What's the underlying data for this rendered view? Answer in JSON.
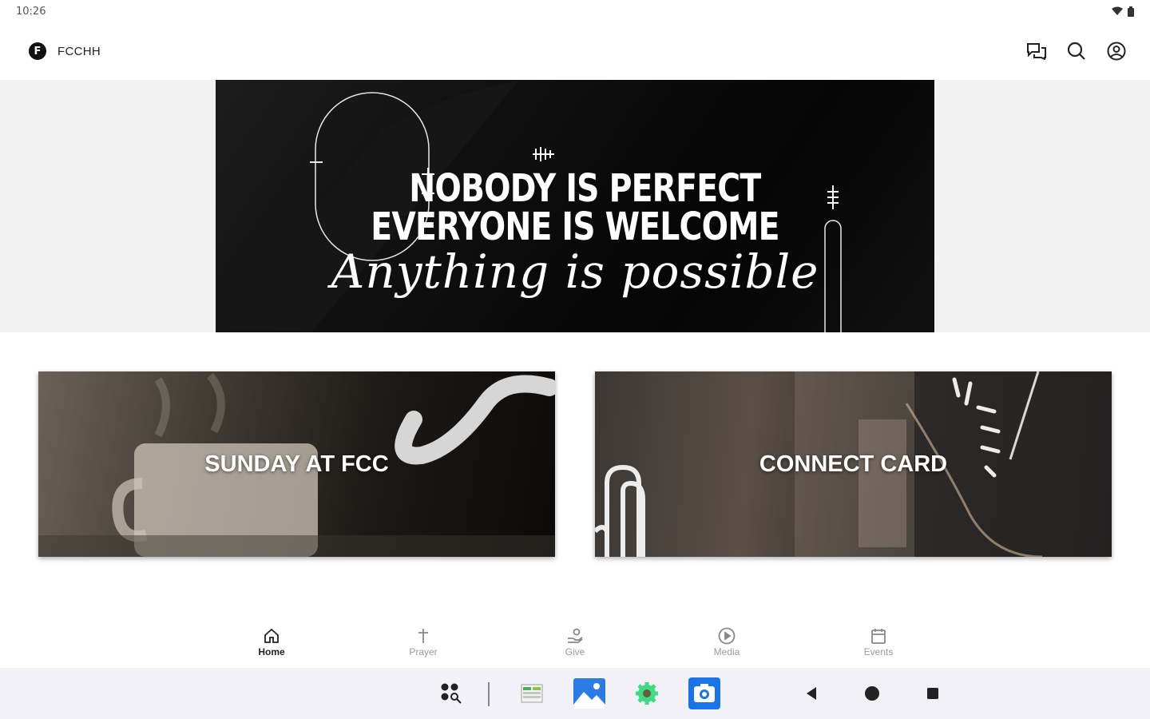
{
  "status_bar": {
    "time": "10:26"
  },
  "app_bar": {
    "logo_letter": "F",
    "title": "FCCHH"
  },
  "hero": {
    "line1": "NOBODY IS PERFECT",
    "line2": "EVERYONE IS WELCOME",
    "line3": "Anything is possible"
  },
  "cards": [
    {
      "label": "SUNDAY AT FCC"
    },
    {
      "label": "CONNECT CARD"
    }
  ],
  "bottom_nav": {
    "items": [
      {
        "label": "Home",
        "icon": "home-icon",
        "active": true
      },
      {
        "label": "Prayer",
        "icon": "cross-icon",
        "active": false
      },
      {
        "label": "Give",
        "icon": "give-icon",
        "active": false
      },
      {
        "label": "Media",
        "icon": "play-icon",
        "active": false
      },
      {
        "label": "Events",
        "icon": "calendar-icon",
        "active": false
      }
    ]
  },
  "system_bar": {
    "taskbar_apps": [
      "app-drawer-icon",
      "sheets-app-icon",
      "gallery-app-icon",
      "settings-app-icon",
      "camera-app-icon"
    ],
    "nav_buttons": [
      "back-button",
      "home-button",
      "recents-button"
    ]
  },
  "colors": {
    "hero_bg": "#0b0b0b",
    "band": "#f1f1f2",
    "system_bar": "#f2f1f7",
    "camera_blue": "#1a73e8",
    "settings_green": "#3ddc84"
  }
}
